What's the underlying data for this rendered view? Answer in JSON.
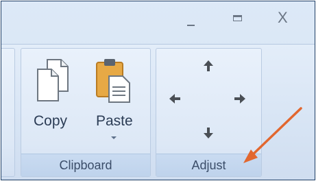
{
  "window": {
    "controls": [
      "minimize",
      "maximize",
      "close"
    ],
    "close_glyph": "X"
  },
  "ribbon": {
    "clipboard_group": {
      "label": "Clipboard",
      "copy_label": "Copy",
      "paste_label": "Paste"
    },
    "adjust_group": {
      "label": "Adjust",
      "arrows": [
        "up-arrow-icon",
        "left-arrow-icon",
        "right-arrow-icon",
        "down-arrow-icon"
      ]
    }
  },
  "annotation": {
    "callout_arrow_color": "#e2672f"
  },
  "colors": {
    "frame_border": "#1f3f66",
    "label_text": "#3b4d69",
    "icon_dark": "#4a4f55"
  }
}
